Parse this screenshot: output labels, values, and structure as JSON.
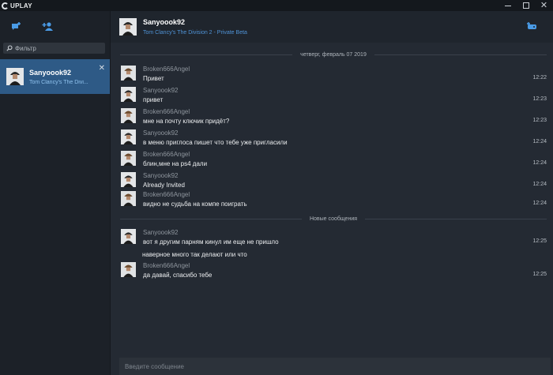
{
  "app": {
    "brand": "UPLAY"
  },
  "window_controls": [
    "minimize",
    "maximize",
    "close"
  ],
  "sidebar": {
    "icons": [
      "chat-add-icon",
      "add-friend-icon"
    ],
    "filter_placeholder": "Фильтр",
    "conversation": {
      "name": "Sanyoook92",
      "subtitle": "Tom Clancy's The Division 2 - Private Beta",
      "subtitle_truncated": "Tom Clancy's The Divi..."
    }
  },
  "header": {
    "name": "Sanyoook92",
    "game": "Tom Clancy's The Division 2 - Private Beta"
  },
  "messages": {
    "date_divider": "четверг, февраль 07 2019",
    "new_divider": "Новые сообщения",
    "items": [
      {
        "author": "Broken666Angel",
        "text": "Привет",
        "time": "12:22"
      },
      {
        "author": "Sanyoook92",
        "text": "привет",
        "time": "12:23"
      },
      {
        "author": "Broken666Angel",
        "text": "мне на почту ключик придёт?",
        "time": "12:23"
      },
      {
        "author": "Sanyoook92",
        "text": "в меню приглоса пишет что тебе уже пригласили",
        "time": "12:24"
      },
      {
        "author": "Broken666Angel",
        "text": "блин,мне на ps4 дали",
        "time": "12:24"
      },
      {
        "author": "Sanyoook92",
        "text": "Already Invited",
        "time": "12:24"
      },
      {
        "author": "Broken666Angel",
        "text": "видно не судьба на компе поиграть",
        "time": "12:24"
      },
      {
        "author": "Sanyoook92",
        "text": "вот я другим парням кинул им еще не пришло",
        "time": "12:25"
      },
      {
        "author": "",
        "text": "наверное много так делают или что",
        "time": ""
      },
      {
        "author": "Broken666Angel",
        "text": "да давай, спасибо тебе",
        "time": "12:25"
      }
    ]
  },
  "composer": {
    "placeholder": "Введите сообщение"
  },
  "colors": {
    "background": "#242a33",
    "sidebar": "#1c2128",
    "selected": "#2e5a86",
    "accent": "#4f93d6"
  }
}
